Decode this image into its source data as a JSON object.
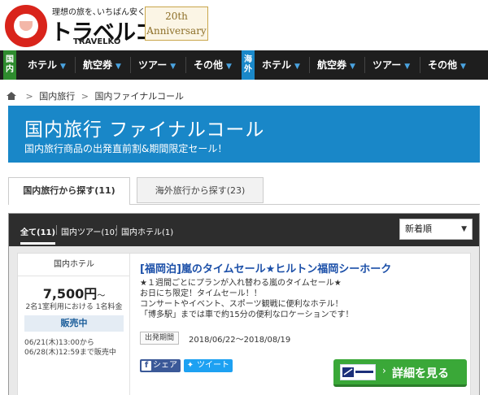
{
  "header": {
    "tagline": "理想の旅を､いちばん安く｡",
    "brand": "トラベルコ",
    "brand_en": "TRAVELKO",
    "anniversary_line1": "20th",
    "anniversary_line2": "Anniversary"
  },
  "nav": {
    "domestic_tag": "国内",
    "international_tag": "海外",
    "domestic": [
      "ホテル",
      "航空券",
      "ツアー",
      "その他"
    ],
    "international": [
      "ホテル",
      "航空券",
      "ツアー",
      "その他"
    ]
  },
  "breadcrumb": [
    "国内旅行",
    "国内ファイナルコール"
  ],
  "banner": {
    "title": "国内旅行 ファイナルコール",
    "subtitle": "国内旅行商品の出発直前割&期間限定セール！"
  },
  "tabs": {
    "domestic": "国内旅行から探す(11)",
    "international": "海外旅行から探す(23)"
  },
  "filters": {
    "all": "全て(11)",
    "tour": "国内ツアー(10)",
    "hotel": "国内ホテル(1)"
  },
  "sort": {
    "selected": "新着順"
  },
  "card": {
    "category": "国内ホテル",
    "price": "7,500円",
    "price_suffix": "～",
    "price_note": "2名1室利用における 1名料金",
    "status": "販売中",
    "sale_period_line1": "06/21(木)13:00から",
    "sale_period_line2": "06/28(木)12:59まで販売中",
    "title": "[福岡泊]嵐のタイムセール★ヒルトン福岡シーホーク",
    "desc_lines": [
      "★１週間ごとにプランが入れ替わる嵐のタイムセール★",
      "お日にち限定！タイムセール！！",
      "コンサートやイベント、スポーツ観戦に便利なホテル！",
      "「博多駅」までは車で約15分の便利なロケーションです！"
    ],
    "departure_label": "出発期間",
    "departure_dates": "2018/06/22～2018/08/19",
    "share_fb": "シェア",
    "share_tw": "ツイート",
    "detail_button": "詳細を見る"
  },
  "colors": {
    "banner": "#1987c8",
    "domestic_tag": "#2e8b2e",
    "international_tag": "#1a88c9",
    "detail_button": "#3aa838",
    "title_link": "#1b4fa8"
  }
}
